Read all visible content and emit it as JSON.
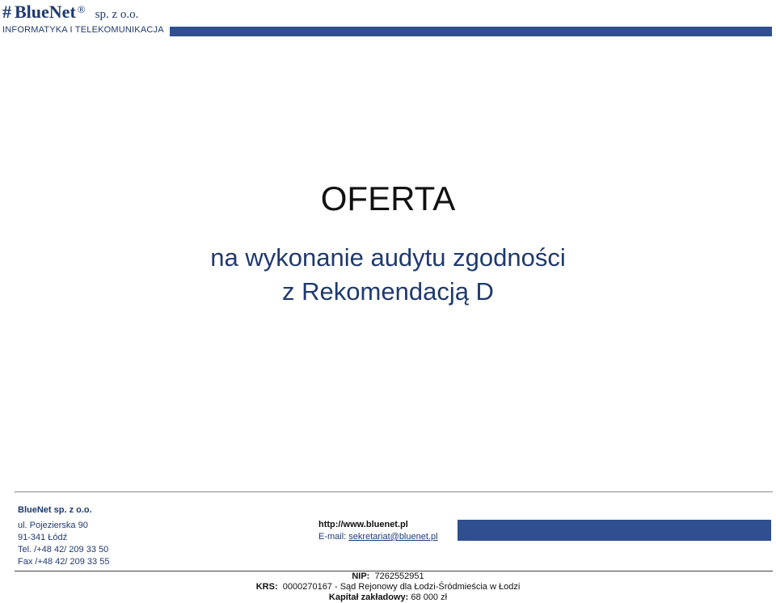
{
  "header": {
    "brand_hash": "#",
    "brand_name": "BlueNet",
    "registered_mark": "®",
    "brand_suffix": "sp. z o.o.",
    "tagline": "INFORMATYKA  I  TELEKOMUNIKACJA",
    "bar_color": "#2f4f8f"
  },
  "document": {
    "title": "OFERTA",
    "subtitle_line1": "na wykonanie audytu zgodności",
    "subtitle_line2": "z Rekomendacją D"
  },
  "footer": {
    "company_name": "BlueNet sp. z o.o.",
    "address_line1": "ul. Pojezierska 90",
    "address_line2": "91-341  Łódź",
    "phone": "Tel.  /+48 42/ 209 33 50",
    "fax": "Fax  /+48 42/ 209 33 55",
    "website": "http://www.bluenet.pl",
    "email_label": "E-mail:",
    "email": "sekretariat@bluenet.pl",
    "nip_label": "NIP:",
    "nip_value": "7262552951",
    "krs_label": "KRS:",
    "krs_value": "0000270167 - Sąd Rejonowy dla Łodzi-Śródmieścia w Łodzi",
    "capital_label": "Kapitał zakładowy:",
    "capital_value": "68 000 zł"
  }
}
